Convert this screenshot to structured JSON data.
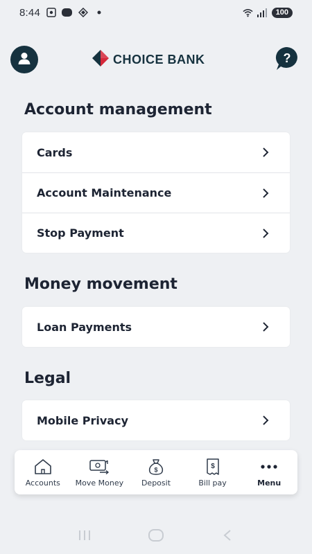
{
  "status_bar": {
    "time": "8:44",
    "battery": "100"
  },
  "header": {
    "brand": "CHOICE BANK"
  },
  "sections": [
    {
      "title": "Account management",
      "items": [
        "Cards",
        "Account Maintenance",
        "Stop Payment"
      ]
    },
    {
      "title": "Money movement",
      "items": [
        "Loan Payments"
      ]
    },
    {
      "title": "Legal",
      "items": [
        "Mobile Privacy"
      ]
    }
  ],
  "bottom_nav": {
    "items": [
      {
        "label": "Accounts",
        "icon": "home-icon"
      },
      {
        "label": "Move Money",
        "icon": "money-transfer-icon"
      },
      {
        "label": "Deposit",
        "icon": "money-bag-icon"
      },
      {
        "label": "Bill pay",
        "icon": "bill-icon"
      },
      {
        "label": "Menu",
        "icon": "more-dots-icon",
        "active": true
      }
    ]
  },
  "colors": {
    "brand_navy": "#16323f",
    "brand_red": "#d6283a",
    "background": "#eef0f3"
  }
}
